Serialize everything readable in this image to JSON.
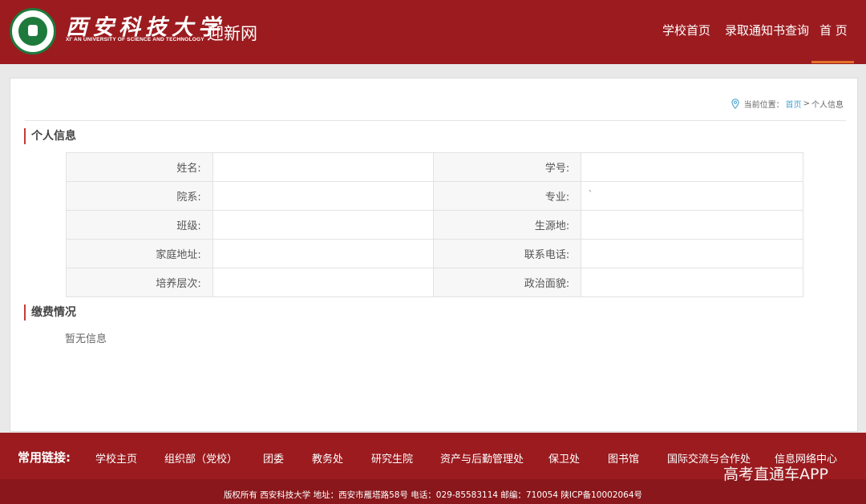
{
  "header": {
    "university_cn": "西安科技大学",
    "university_en": "XI' AN UNIVERSITY OF SCIENCE AND TECHNOLOGY",
    "site_name": "迎新网",
    "nav": [
      "学校首页",
      "录取通知书查询",
      "首 页"
    ]
  },
  "breadcrumb": {
    "prefix": "当前位置：",
    "home": "首页",
    "sep": " > ",
    "current": "个人信息"
  },
  "personal": {
    "title": "个人信息",
    "rows": [
      {
        "l1": "姓名:",
        "v1": "",
        "l2": "学号:",
        "v2": ""
      },
      {
        "l1": "院系:",
        "v1": "",
        "l2": "专业:",
        "v2": "`"
      },
      {
        "l1": "班级:",
        "v1": "",
        "l2": "生源地:",
        "v2": ""
      },
      {
        "l1": "家庭地址:",
        "v1": "",
        "l2": "联系电话:",
        "v2": ""
      },
      {
        "l1": "培养层次:",
        "v1": "",
        "l2": "政治面貌:",
        "v2": ""
      }
    ]
  },
  "payment": {
    "title": "缴费情况",
    "empty": "暂无信息"
  },
  "footer": {
    "links_title": "常用链接:",
    "links": [
      "学校主页",
      "组织部（党校）",
      "团委",
      "教务处",
      "研究生院",
      "资产与后勤管理处",
      "保卫处",
      "图书馆",
      "国际交流与合作处",
      "信息网络中心"
    ],
    "copyright": "版权所有 西安科技大学 地址：西安市雁塔路58号 电话：029-85583114 邮编：710054 陕ICP备10002064号",
    "watermark": "高考直通车APP"
  },
  "colors": {
    "primary": "#9b1b1f",
    "accent": "#e2712a",
    "link": "#4aa3cf"
  }
}
